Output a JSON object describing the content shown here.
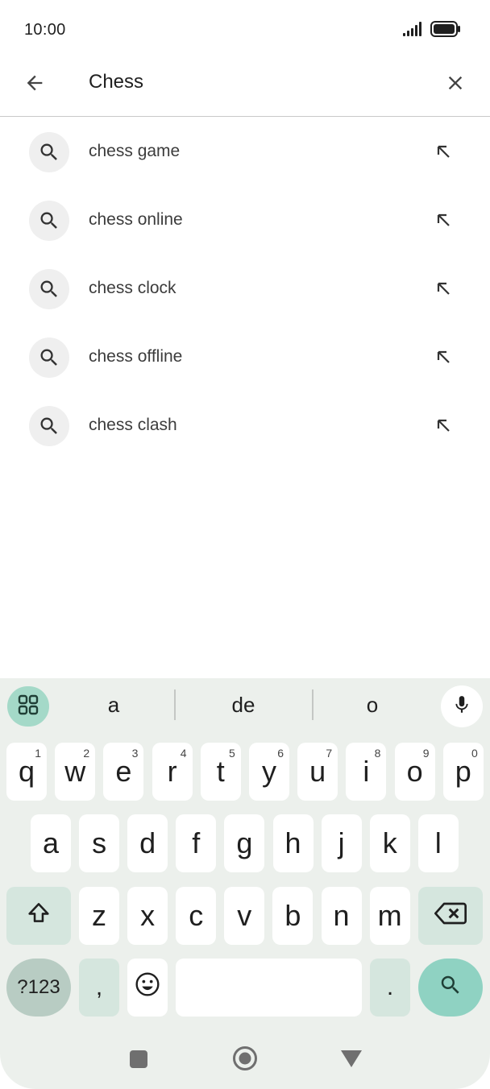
{
  "status": {
    "time": "10:00"
  },
  "search": {
    "query": "Chess"
  },
  "suggestions": [
    {
      "text": "chess game"
    },
    {
      "text": "chess online"
    },
    {
      "text": "chess clock"
    },
    {
      "text": "chess offline"
    },
    {
      "text": "chess clash"
    }
  ],
  "keyboard": {
    "word_suggestions": [
      "a",
      "de",
      "o"
    ],
    "row1": [
      {
        "k": "q",
        "h": "1"
      },
      {
        "k": "w",
        "h": "2"
      },
      {
        "k": "e",
        "h": "3"
      },
      {
        "k": "r",
        "h": "4"
      },
      {
        "k": "t",
        "h": "5"
      },
      {
        "k": "y",
        "h": "6"
      },
      {
        "k": "u",
        "h": "7"
      },
      {
        "k": "i",
        "h": "8"
      },
      {
        "k": "o",
        "h": "9"
      },
      {
        "k": "p",
        "h": "0"
      }
    ],
    "row2": [
      "a",
      "s",
      "d",
      "f",
      "g",
      "h",
      "j",
      "k",
      "l"
    ],
    "row3": [
      "z",
      "x",
      "c",
      "v",
      "b",
      "n",
      "m"
    ],
    "symbols_label": "?123",
    "comma": ",",
    "period": "."
  },
  "icons": {
    "back": "arrow-back-icon",
    "clear": "close-icon",
    "suggestion": "search-icon",
    "fill": "arrow-up-left-icon",
    "apps": "grid-apps-icon",
    "mic": "microphone-icon",
    "shift": "shift-icon",
    "backspace": "backspace-icon",
    "emoji": "emoji-icon",
    "kb_search": "search-icon"
  },
  "colors": {
    "keyboard_bg": "#ecf0ec",
    "accent": "#8fd2c2",
    "apps_btn": "#a4d9c8"
  }
}
